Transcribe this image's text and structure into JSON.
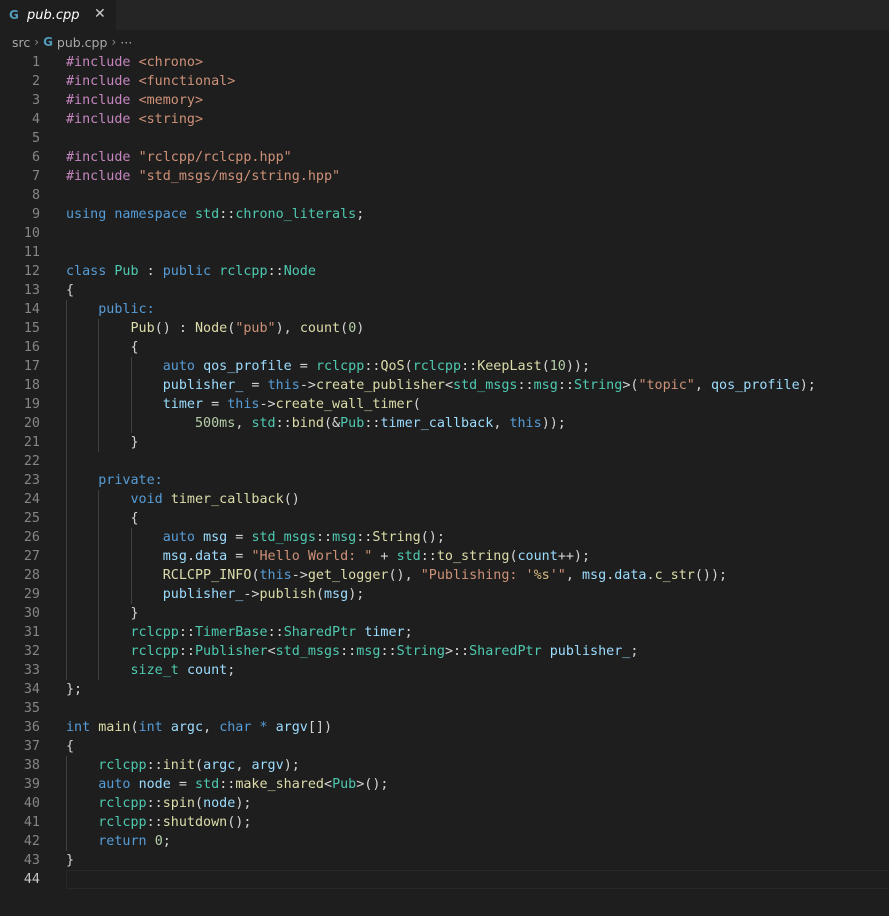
{
  "tab": {
    "label": "pub.cpp",
    "icon": "cpp-file-icon",
    "close": "✕"
  },
  "breadcrumb": {
    "folder": "src",
    "file": "pub.cpp",
    "more": "···"
  },
  "editor": {
    "current_line": 44,
    "lines": [
      [
        [
          "pp",
          "#include "
        ],
        [
          "str",
          "<chrono>"
        ]
      ],
      [
        [
          "pp",
          "#include "
        ],
        [
          "str",
          "<functional>"
        ]
      ],
      [
        [
          "pp",
          "#include "
        ],
        [
          "str",
          "<memory>"
        ]
      ],
      [
        [
          "pp",
          "#include "
        ],
        [
          "str",
          "<string>"
        ]
      ],
      [],
      [
        [
          "pp",
          "#include "
        ],
        [
          "str",
          "\"rclcpp/rclcpp.hpp\""
        ]
      ],
      [
        [
          "pp",
          "#include "
        ],
        [
          "str",
          "\"std_msgs/msg/string.hpp\""
        ]
      ],
      [],
      [
        [
          "kw",
          "using"
        ],
        [
          "pl",
          " "
        ],
        [
          "kw",
          "namespace"
        ],
        [
          "pl",
          " "
        ],
        [
          "ty",
          "std"
        ],
        [
          "pl",
          "::"
        ],
        [
          "ty",
          "chrono_literals"
        ],
        [
          "pl",
          ";"
        ]
      ],
      [],
      [],
      [
        [
          "kw",
          "class"
        ],
        [
          "pl",
          " "
        ],
        [
          "ty",
          "Pub"
        ],
        [
          "pl",
          " : "
        ],
        [
          "kw",
          "public"
        ],
        [
          "pl",
          " "
        ],
        [
          "ty",
          "rclcpp"
        ],
        [
          "pl",
          "::"
        ],
        [
          "ty",
          "Node"
        ]
      ],
      [
        [
          "pl",
          "{"
        ]
      ],
      [
        [
          "pl",
          "    "
        ],
        [
          "kw",
          "public:"
        ]
      ],
      [
        [
          "pl",
          "        "
        ],
        [
          "fn",
          "Pub"
        ],
        [
          "pl",
          "() : "
        ],
        [
          "fn",
          "Node"
        ],
        [
          "pl",
          "("
        ],
        [
          "str",
          "\"pub\""
        ],
        [
          "pl",
          "), "
        ],
        [
          "fn",
          "count"
        ],
        [
          "pl",
          "("
        ],
        [
          "num",
          "0"
        ],
        [
          "pl",
          ")"
        ]
      ],
      [
        [
          "pl",
          "        {"
        ]
      ],
      [
        [
          "pl",
          "            "
        ],
        [
          "kw",
          "auto"
        ],
        [
          "pl",
          " "
        ],
        [
          "var",
          "qos_profile"
        ],
        [
          "pl",
          " = "
        ],
        [
          "ty",
          "rclcpp"
        ],
        [
          "pl",
          "::"
        ],
        [
          "fn",
          "QoS"
        ],
        [
          "pl",
          "("
        ],
        [
          "ty",
          "rclcpp"
        ],
        [
          "pl",
          "::"
        ],
        [
          "fn",
          "KeepLast"
        ],
        [
          "pl",
          "("
        ],
        [
          "num",
          "10"
        ],
        [
          "pl",
          "));"
        ]
      ],
      [
        [
          "pl",
          "            "
        ],
        [
          "var",
          "publisher_"
        ],
        [
          "pl",
          " = "
        ],
        [
          "kw",
          "this"
        ],
        [
          "pl",
          "->"
        ],
        [
          "fn",
          "create_publisher"
        ],
        [
          "pl",
          "<"
        ],
        [
          "ty",
          "std_msgs"
        ],
        [
          "pl",
          "::"
        ],
        [
          "ty",
          "msg"
        ],
        [
          "pl",
          "::"
        ],
        [
          "ty",
          "String"
        ],
        [
          "pl",
          ">("
        ],
        [
          "str",
          "\"topic\""
        ],
        [
          "pl",
          ", "
        ],
        [
          "var",
          "qos_profile"
        ],
        [
          "pl",
          ");"
        ]
      ],
      [
        [
          "pl",
          "            "
        ],
        [
          "var",
          "timer"
        ],
        [
          "pl",
          " = "
        ],
        [
          "kw",
          "this"
        ],
        [
          "pl",
          "->"
        ],
        [
          "fn",
          "create_wall_timer"
        ],
        [
          "pl",
          "("
        ]
      ],
      [
        [
          "pl",
          "                "
        ],
        [
          "num",
          "500ms"
        ],
        [
          "pl",
          ", "
        ],
        [
          "ty",
          "std"
        ],
        [
          "pl",
          "::"
        ],
        [
          "fn",
          "bind"
        ],
        [
          "pl",
          "(&"
        ],
        [
          "ty",
          "Pub"
        ],
        [
          "pl",
          "::"
        ],
        [
          "var",
          "timer_callback"
        ],
        [
          "pl",
          ", "
        ],
        [
          "kw",
          "this"
        ],
        [
          "pl",
          "));"
        ]
      ],
      [
        [
          "pl",
          "        }"
        ]
      ],
      [],
      [
        [
          "pl",
          "    "
        ],
        [
          "kw",
          "private:"
        ]
      ],
      [
        [
          "pl",
          "        "
        ],
        [
          "kw",
          "void"
        ],
        [
          "pl",
          " "
        ],
        [
          "fn",
          "timer_callback"
        ],
        [
          "pl",
          "()"
        ]
      ],
      [
        [
          "pl",
          "        {"
        ]
      ],
      [
        [
          "pl",
          "            "
        ],
        [
          "kw",
          "auto"
        ],
        [
          "pl",
          " "
        ],
        [
          "var",
          "msg"
        ],
        [
          "pl",
          " = "
        ],
        [
          "ty",
          "std_msgs"
        ],
        [
          "pl",
          "::"
        ],
        [
          "ty",
          "msg"
        ],
        [
          "pl",
          "::"
        ],
        [
          "fn",
          "String"
        ],
        [
          "pl",
          "();"
        ]
      ],
      [
        [
          "pl",
          "            "
        ],
        [
          "var",
          "msg"
        ],
        [
          "pl",
          "."
        ],
        [
          "var",
          "data"
        ],
        [
          "pl",
          " = "
        ],
        [
          "str",
          "\"Hello World: \""
        ],
        [
          "pl",
          " + "
        ],
        [
          "ty",
          "std"
        ],
        [
          "pl",
          "::"
        ],
        [
          "fn",
          "to_string"
        ],
        [
          "pl",
          "("
        ],
        [
          "var",
          "count"
        ],
        [
          "pl",
          "++);"
        ]
      ],
      [
        [
          "pl",
          "            "
        ],
        [
          "fn",
          "RCLCPP_INFO"
        ],
        [
          "pl",
          "("
        ],
        [
          "kw",
          "this"
        ],
        [
          "pl",
          "->"
        ],
        [
          "fn",
          "get_logger"
        ],
        [
          "pl",
          "(), "
        ],
        [
          "str",
          "\"Publishing: '"
        ],
        [
          "esc",
          "%s"
        ],
        [
          "str",
          "'\""
        ],
        [
          "pl",
          ", "
        ],
        [
          "var",
          "msg"
        ],
        [
          "pl",
          "."
        ],
        [
          "var",
          "data"
        ],
        [
          "pl",
          "."
        ],
        [
          "fn",
          "c_str"
        ],
        [
          "pl",
          "());"
        ]
      ],
      [
        [
          "pl",
          "            "
        ],
        [
          "var",
          "publisher_"
        ],
        [
          "pl",
          "->"
        ],
        [
          "fn",
          "publish"
        ],
        [
          "pl",
          "("
        ],
        [
          "var",
          "msg"
        ],
        [
          "pl",
          ");"
        ]
      ],
      [
        [
          "pl",
          "        }"
        ]
      ],
      [
        [
          "pl",
          "        "
        ],
        [
          "ty",
          "rclcpp"
        ],
        [
          "pl",
          "::"
        ],
        [
          "ty",
          "TimerBase"
        ],
        [
          "pl",
          "::"
        ],
        [
          "ty",
          "SharedPtr"
        ],
        [
          "pl",
          " "
        ],
        [
          "var",
          "timer"
        ],
        [
          "pl",
          ";"
        ]
      ],
      [
        [
          "pl",
          "        "
        ],
        [
          "ty",
          "rclcpp"
        ],
        [
          "pl",
          "::"
        ],
        [
          "ty",
          "Publisher"
        ],
        [
          "pl",
          "<"
        ],
        [
          "ty",
          "std_msgs"
        ],
        [
          "pl",
          "::"
        ],
        [
          "ty",
          "msg"
        ],
        [
          "pl",
          "::"
        ],
        [
          "ty",
          "String"
        ],
        [
          "pl",
          ">::"
        ],
        [
          "ty",
          "SharedPtr"
        ],
        [
          "pl",
          " "
        ],
        [
          "var",
          "publisher_"
        ],
        [
          "pl",
          ";"
        ]
      ],
      [
        [
          "pl",
          "        "
        ],
        [
          "ty",
          "size_t"
        ],
        [
          "pl",
          " "
        ],
        [
          "var",
          "count"
        ],
        [
          "pl",
          ";"
        ]
      ],
      [
        [
          "pl",
          "};"
        ]
      ],
      [],
      [
        [
          "kw",
          "int"
        ],
        [
          "pl",
          " "
        ],
        [
          "fn",
          "main"
        ],
        [
          "pl",
          "("
        ],
        [
          "kw",
          "int"
        ],
        [
          "pl",
          " "
        ],
        [
          "var",
          "argc"
        ],
        [
          "pl",
          ", "
        ],
        [
          "kw",
          "char"
        ],
        [
          "pl",
          " "
        ],
        [
          "kw",
          "*"
        ],
        [
          "pl",
          " "
        ],
        [
          "var",
          "argv"
        ],
        [
          "pl",
          "[])"
        ]
      ],
      [
        [
          "pl",
          "{"
        ]
      ],
      [
        [
          "pl",
          "    "
        ],
        [
          "ty",
          "rclcpp"
        ],
        [
          "pl",
          "::"
        ],
        [
          "fn",
          "init"
        ],
        [
          "pl",
          "("
        ],
        [
          "var",
          "argc"
        ],
        [
          "pl",
          ", "
        ],
        [
          "var",
          "argv"
        ],
        [
          "pl",
          ");"
        ]
      ],
      [
        [
          "pl",
          "    "
        ],
        [
          "kw",
          "auto"
        ],
        [
          "pl",
          " "
        ],
        [
          "var",
          "node"
        ],
        [
          "pl",
          " = "
        ],
        [
          "ty",
          "std"
        ],
        [
          "pl",
          "::"
        ],
        [
          "fn",
          "make_shared"
        ],
        [
          "pl",
          "<"
        ],
        [
          "ty",
          "Pub"
        ],
        [
          "pl",
          ">();"
        ]
      ],
      [
        [
          "pl",
          "    "
        ],
        [
          "ty",
          "rclcpp"
        ],
        [
          "pl",
          "::"
        ],
        [
          "fn",
          "spin"
        ],
        [
          "pl",
          "("
        ],
        [
          "var",
          "node"
        ],
        [
          "pl",
          ");"
        ]
      ],
      [
        [
          "pl",
          "    "
        ],
        [
          "ty",
          "rclcpp"
        ],
        [
          "pl",
          "::"
        ],
        [
          "fn",
          "shutdown"
        ],
        [
          "pl",
          "();"
        ]
      ],
      [
        [
          "pl",
          "    "
        ],
        [
          "kw",
          "return"
        ],
        [
          "pl",
          " "
        ],
        [
          "num",
          "0"
        ],
        [
          "pl",
          ";"
        ]
      ],
      [
        [
          "pl",
          "}"
        ]
      ],
      []
    ]
  }
}
